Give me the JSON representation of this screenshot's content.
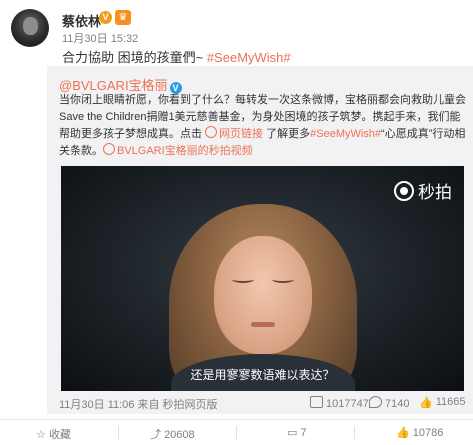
{
  "post": {
    "username": "蔡依林",
    "v_badge": "V",
    "crown_badge": "♛",
    "timestamp": "11月30日 15:32",
    "text": "合力協助 困境的孩童們~ ",
    "hashtag": "#SeeMyWish#"
  },
  "repost": {
    "user": "@BVLGARI宝格丽",
    "blue_v": "V",
    "text_part1": "当你闭上眼睛祈愿，你看到了什么？每转发一次这条微博，宝格丽都会向救助儿童会Save the Children捐赠1美元慈善基金，为身处困境的孩子筑梦。携起手来，我们能帮助更多孩子梦想成真。点击 ",
    "link1": "网页链接",
    "text_part2": " 了解更多",
    "hashtag": "#SeeMyWish#",
    "text_part3": "“心愿成真”行动相关条款。",
    "link2": "BVLGARI宝格丽的秒拍视频",
    "video": {
      "logo": "秒拍",
      "subtitle": "还是用寥寥数语难以表达？"
    },
    "meta": "11月30日 11:06 来自 秒拍网页版",
    "shares": "1017747",
    "comments": "7140",
    "likes": "11665"
  },
  "actions": {
    "favorite": "收藏",
    "share_count": "20608",
    "comment_count": "7",
    "like_count": "10786"
  },
  "colors": {
    "accent": "#eb7350",
    "verified_blue": "#2e9ae6",
    "verified_orange": "#f19b1a"
  }
}
